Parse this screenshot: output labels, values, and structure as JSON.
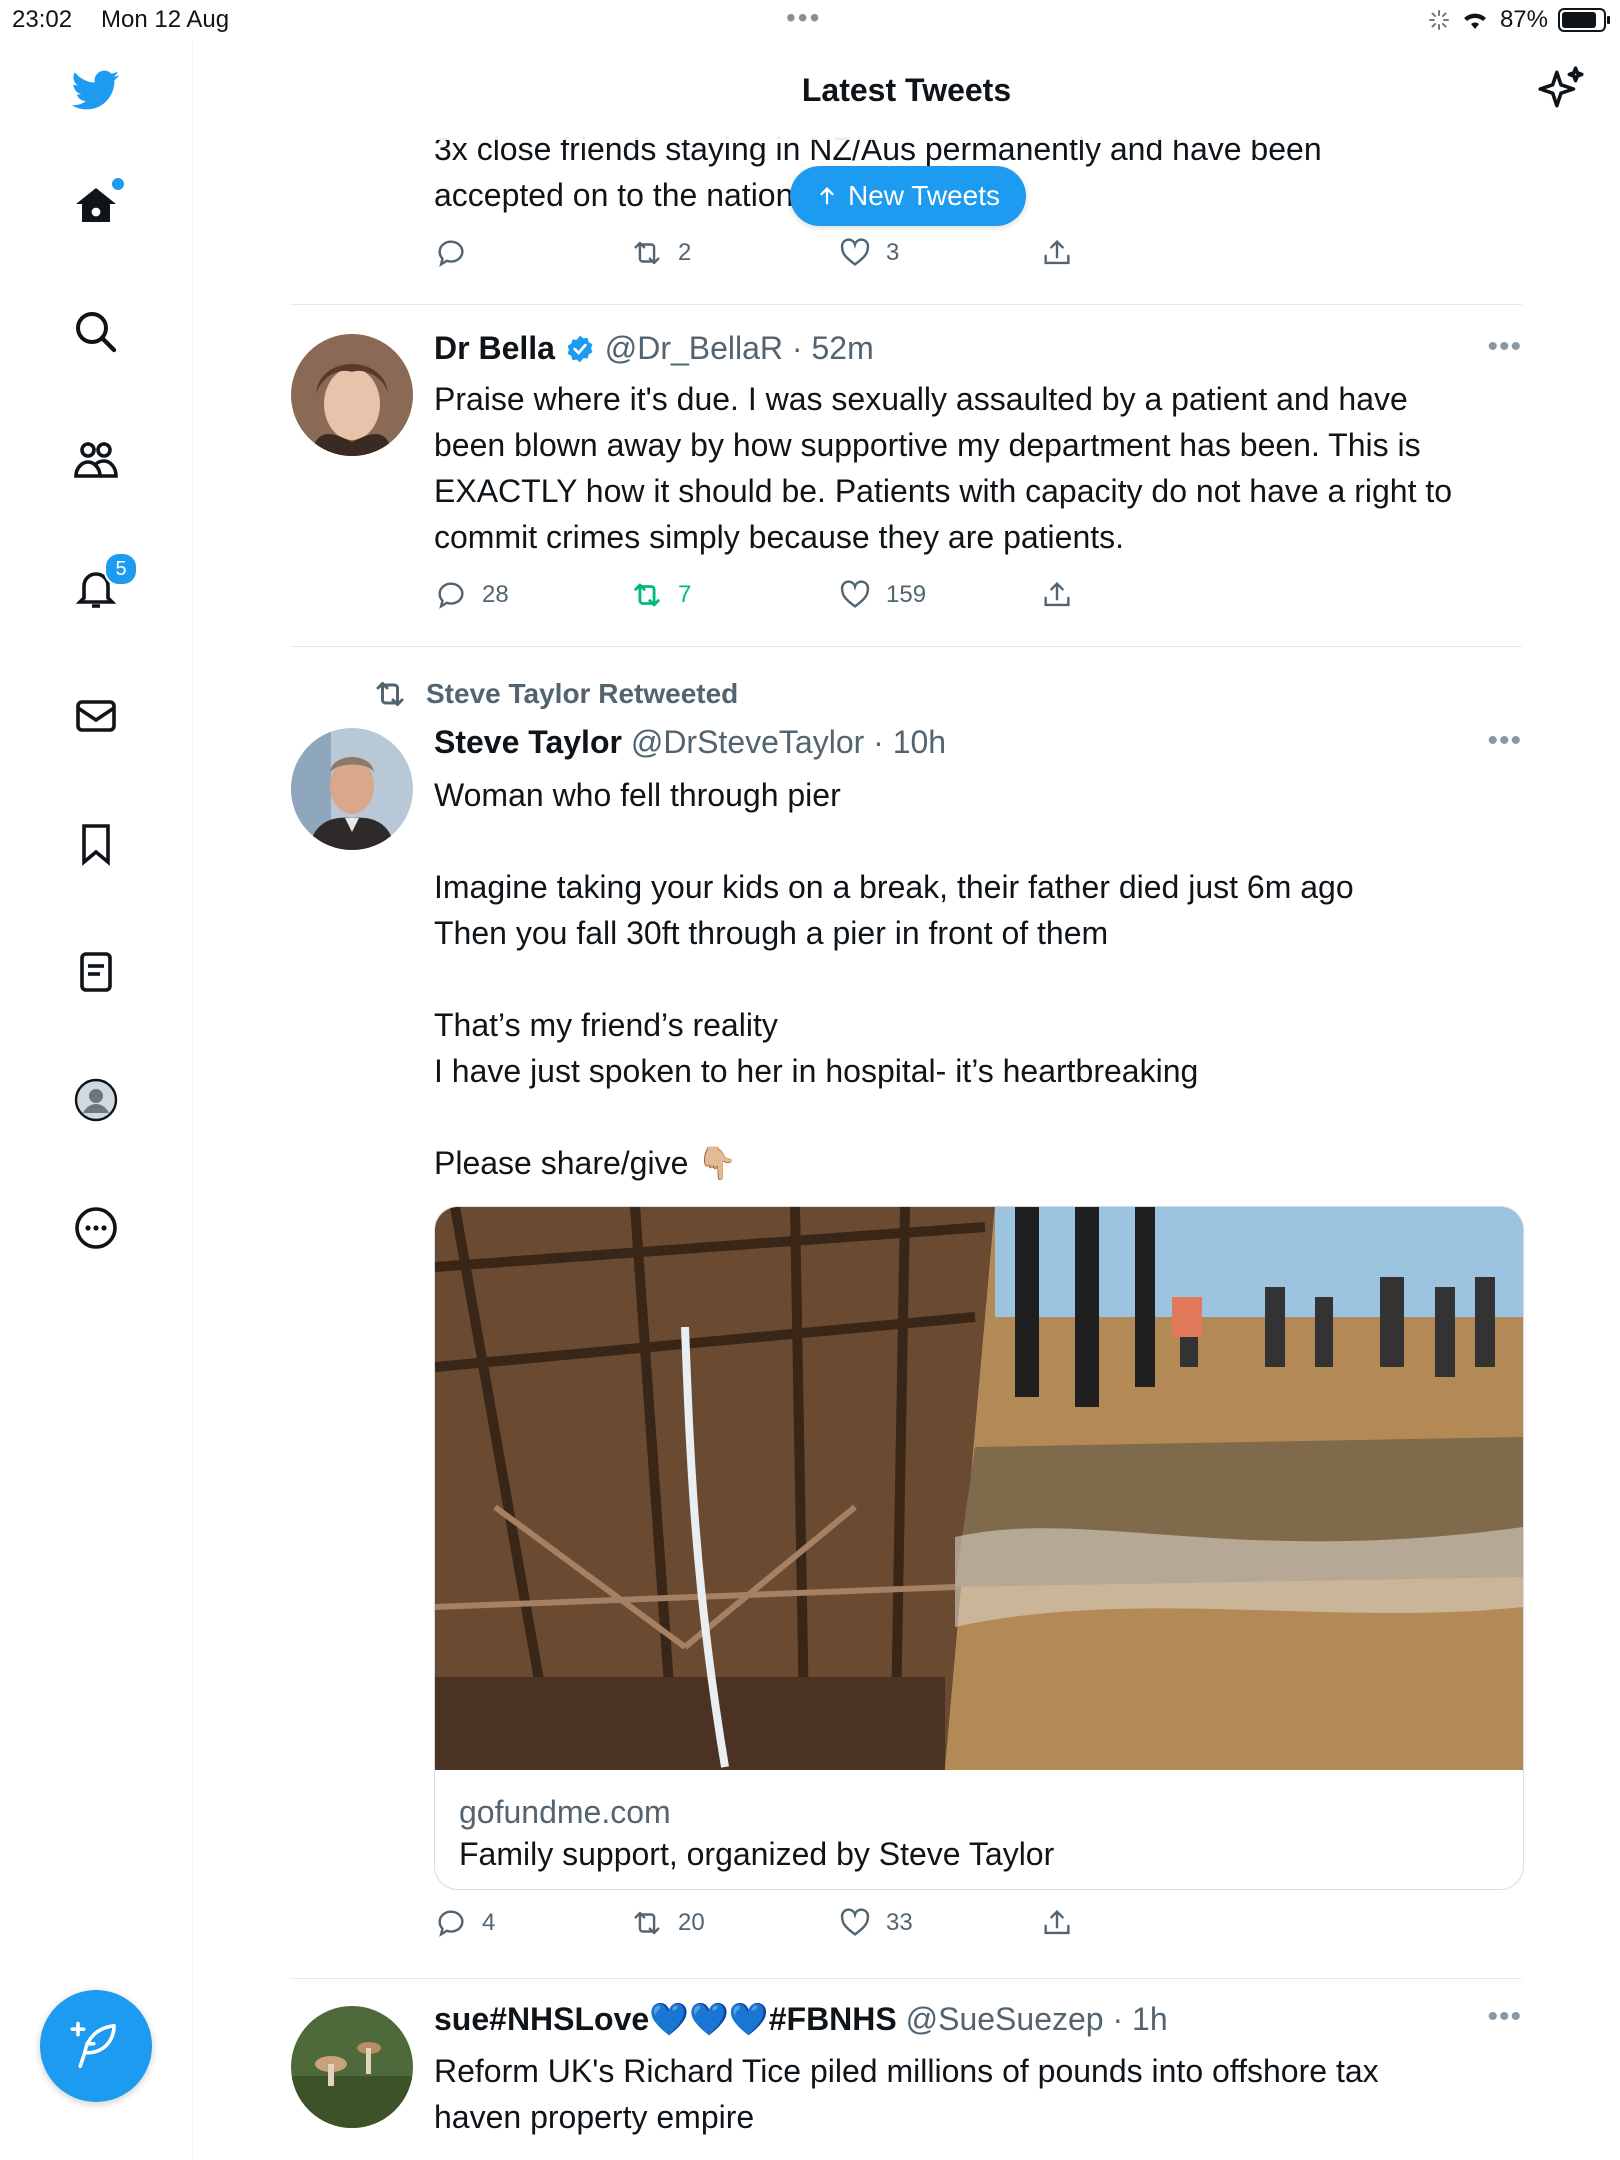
{
  "status_bar": {
    "time": "23:02",
    "date": "Mon 12 Aug",
    "dots": "•••",
    "battery": "87%"
  },
  "header": {
    "title": "Latest Tweets"
  },
  "sidebar": {
    "notifications_badge": "5"
  },
  "new_tweets_button": {
    "label": "New Tweets"
  },
  "colors": {
    "accent": "#1d9bf0",
    "retweet_active": "#00ba7c",
    "muted": "#536471"
  },
  "tweets": [
    {
      "text_lines": [
        "3x close friends staying in NZ/Aus permanently and have been",
        "accepted on to the national pathway."
      ],
      "replies": "",
      "retweets": "2",
      "likes": "3"
    },
    {
      "name": "Dr Bella",
      "verified": true,
      "handle": "@Dr_BellaR",
      "time": "· 52m",
      "text_lines": [
        "Praise where it's due. I was sexually assaulted by a patient and have",
        "been blown away by how supportive my department has been. This is",
        "EXACTLY how it should be. Patients with capacity do not have a right to",
        "commit crimes simply because they are patients."
      ],
      "replies": "28",
      "retweets": "7",
      "likes": "159"
    },
    {
      "retweeted_by": "Steve Taylor Retweeted",
      "name": "Steve Taylor",
      "handle": "@DrSteveTaylor",
      "time": "· 10h",
      "text_lines": [
        "Woman who fell through pier",
        "",
        "Imagine taking your kids on a break, their father died just 6m ago",
        "Then you fall 30ft through a pier in front of them",
        "",
        "That’s my friend’s reality",
        "I have just spoken to her in hospital- it’s heartbreaking",
        "",
        "Please share/give 👇🏼"
      ],
      "card": {
        "domain": "gofundme.com",
        "title": "Family support, organized by Steve Taylor"
      },
      "replies": "4",
      "retweets": "20",
      "likes": "33"
    },
    {
      "name": "sue#NHSLove💙💙💙#FBNHS",
      "handle": "@SueSuezep",
      "time": "· 1h",
      "text_lines": [
        "Reform UK's Richard Tice piled millions of pounds into offshore tax",
        "haven property empire"
      ]
    }
  ]
}
